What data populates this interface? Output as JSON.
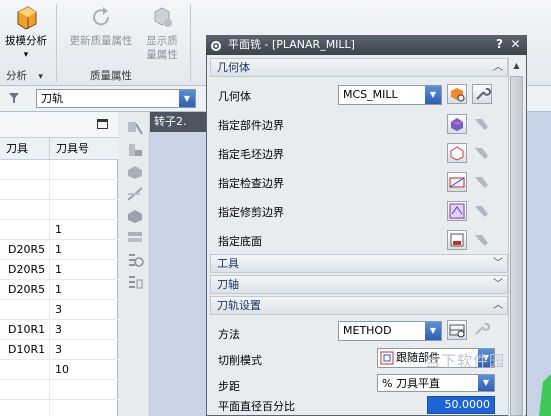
{
  "ribbon": {
    "draft_analysis": {
      "label": "拔模分析",
      "arrow": "▾"
    },
    "refresh_quality": {
      "label": "更新质量属性"
    },
    "show_quality": {
      "label": "显示质量属性"
    },
    "group_analysis": "分析",
    "group_analysis_arrow": "▾",
    "group_quality": "质量属性"
  },
  "toolbar": {
    "combo_value": "刀轨"
  },
  "left_table": {
    "headers": [
      "刀具",
      "刀具号"
    ],
    "rows": [
      [
        "",
        ""
      ],
      [
        "",
        ""
      ],
      [
        "",
        ""
      ],
      [
        "",
        "1"
      ],
      [
        "D20R5",
        "1"
      ],
      [
        "D20R5",
        "1"
      ],
      [
        "D20R5",
        "1"
      ],
      [
        "",
        "3"
      ],
      [
        "D10R1",
        "3"
      ],
      [
        "D10R1",
        "3"
      ],
      [
        "",
        "10"
      ],
      [
        "",
        ""
      ],
      [
        "",
        ""
      ]
    ]
  },
  "bg_tab": {
    "label": "转子2."
  },
  "dialog": {
    "title": "平面铣 - [PLANAR_MILL]",
    "help": "?",
    "close": "✕",
    "sections": {
      "geometry": "几何体",
      "tool": "工具",
      "tool_axis": "刀轴",
      "path_settings": "刀轨设置"
    },
    "geometry": {
      "label": "几何体",
      "value": "MCS_MILL",
      "rows": [
        {
          "label": "指定部件边界"
        },
        {
          "label": "指定毛坯边界"
        },
        {
          "label": "指定检查边界"
        },
        {
          "label": "指定修剪边界"
        },
        {
          "label": "指定底面"
        }
      ]
    },
    "path": {
      "method_label": "方法",
      "method_value": "METHOD",
      "cut_mode_label": "切削模式",
      "cut_mode_value": "跟随部件",
      "step_label": "步距",
      "step_value": "% 刀具平直",
      "plane_pct_label": "平面直径百分比",
      "plane_pct_value": "50.0000"
    }
  },
  "watermark": "当下软件园",
  "colors": {
    "accent_blue": "#2f5fb0",
    "title_dark": "#3c434c",
    "section_text": "#17355f"
  }
}
